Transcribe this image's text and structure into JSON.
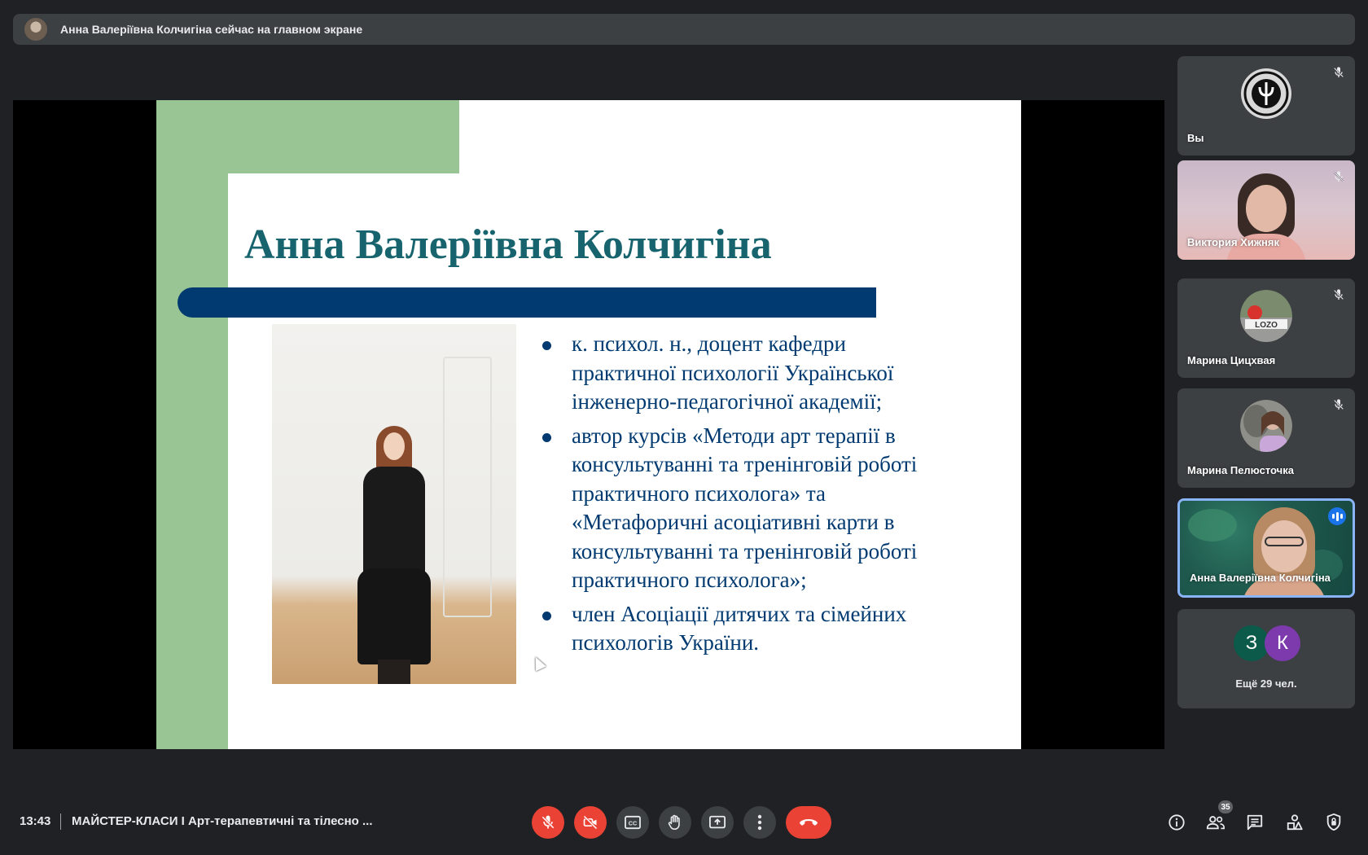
{
  "banner": {
    "text": "Анна Валеріївна Колчигіна сейчас на главном экране"
  },
  "slide": {
    "title": "Анна Валеріївна Колчигіна",
    "bullets": [
      "к. психол. н., доцент кафедри практичної психології Української інженерно-педагогічної академії;",
      "автор курсів «Методи арт терапії в консультуванні та тренінговій роботі практичного психолога» та «Метафоричні асоціативні карти в консультуванні та тренінговій роботі практичного психолога»;",
      " член Асоціації дитячих та сімейних психологів України."
    ],
    "colors": {
      "title": "#17646e",
      "bar": "#003a70",
      "green": "#99c595",
      "text": "#003a70"
    }
  },
  "participants": [
    {
      "name": "Вы",
      "muted": true,
      "avatar": "emblem"
    },
    {
      "name": "Виктория Хижняк",
      "muted": true,
      "avatar": "video"
    },
    {
      "name": "Марина Цицхвая",
      "muted": true,
      "avatar": "photo"
    },
    {
      "name": "Марина Пелюсточка",
      "muted": true,
      "avatar": "photo"
    },
    {
      "name": "Анна Валеріївна Колчигіна",
      "muted": false,
      "speaking": true,
      "avatar": "video"
    }
  ],
  "more": {
    "avatars": [
      {
        "letter": "З",
        "color": "#0b5a4a"
      },
      {
        "letter": "К",
        "color": "#7c3aad"
      }
    ],
    "label": "Ещё 29 чел."
  },
  "bottom": {
    "time": "13:43",
    "meeting_title": "МАЙСТЕР-КЛАСИ І Арт-терапевтичні та тілесно ...",
    "people_count": "35"
  },
  "controls": [
    "mic-off-icon",
    "camera-off-icon",
    "captions-icon",
    "raise-hand-icon",
    "present-icon",
    "more-options-icon",
    "hang-up-icon"
  ],
  "right_controls": [
    "info-icon",
    "people-icon",
    "chat-icon",
    "activities-icon",
    "host-controls-icon"
  ],
  "accent": {
    "red": "#ea4335",
    "speaking": "#8ab4f8",
    "dark": "#202124",
    "tile": "#3c4043"
  }
}
